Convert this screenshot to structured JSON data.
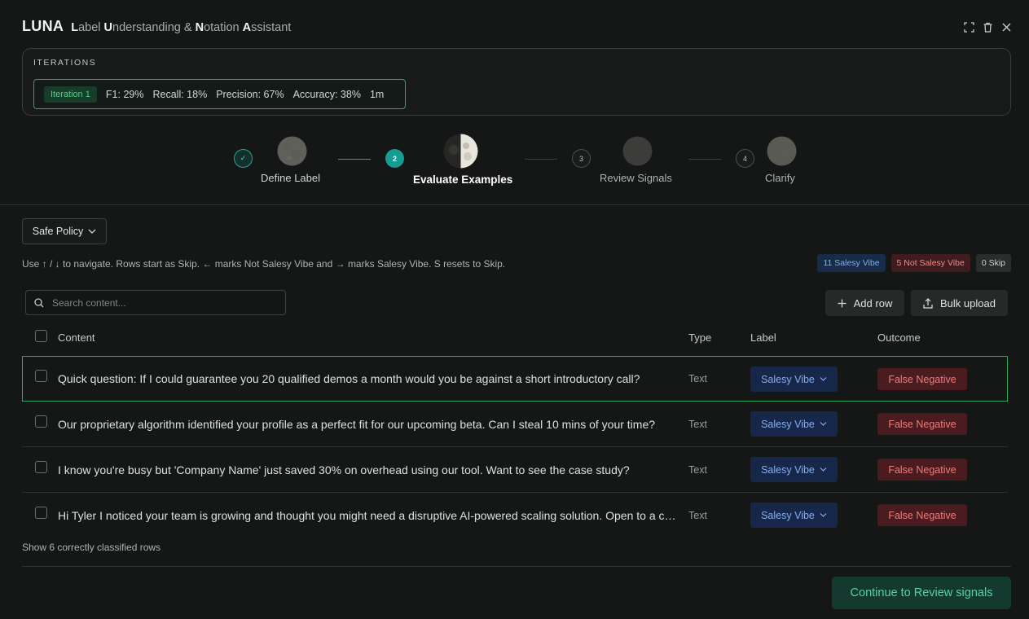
{
  "header": {
    "brand": "LUNA",
    "subtitle_parts": [
      {
        "b": "L",
        "t": "abel "
      },
      {
        "b": "U",
        "t": "nderstanding & "
      },
      {
        "b": "N",
        "t": "otation "
      },
      {
        "b": "A",
        "t": "ssistant"
      }
    ],
    "icons": [
      "expand-icon",
      "trash-icon",
      "close-icon"
    ]
  },
  "iterations": {
    "heading": "ITERATIONS",
    "items": [
      {
        "badge": "Iteration 1",
        "f1": "F1: 29%",
        "recall": "Recall: 18%",
        "precision": "Precision: 67%",
        "accuracy": "Accuracy: 38%",
        "time": "1m"
      }
    ]
  },
  "stepper": {
    "steps": [
      {
        "num": "✓",
        "label": "Define Label",
        "status": "done"
      },
      {
        "num": "2",
        "label": "Evaluate Examples",
        "status": "active"
      },
      {
        "num": "3",
        "label": "Review Signals",
        "status": "todo"
      },
      {
        "num": "4",
        "label": "Clarify",
        "status": "todo"
      }
    ]
  },
  "policy": {
    "selected": "Safe Policy"
  },
  "hint": "Use ↑ / ↓ to navigate. Rows start as Skip. ← marks Not Salesy Vibe and → marks Salesy Vibe. S resets to Skip.",
  "counts": {
    "positive": "11 Salesy Vibe",
    "negative": "5 Not Salesy Vibe",
    "skip": "0 Skip"
  },
  "search": {
    "placeholder": "Search content..."
  },
  "actions": {
    "add_row": "Add row",
    "bulk_upload": "Bulk upload"
  },
  "table": {
    "headers": {
      "content": "Content",
      "type": "Type",
      "label": "Label",
      "outcome": "Outcome"
    },
    "rows": [
      {
        "content": "Quick question: If I could guarantee you 20 qualified demos a month would you be against a short introductory call?",
        "type": "Text",
        "label": "Salesy Vibe",
        "outcome": "False Negative"
      },
      {
        "content": "Our proprietary algorithm identified your profile as a perfect fit for our upcoming beta. Can I steal 10 mins of your time?",
        "type": "Text",
        "label": "Salesy Vibe",
        "outcome": "False Negative"
      },
      {
        "content": "I know you're busy but 'Company Name' just saved 30% on overhead using our tool. Want to see the case study?",
        "type": "Text",
        "label": "Salesy Vibe",
        "outcome": "False Negative"
      },
      {
        "content": "Hi Tyler I noticed your team is growing and thought you might need a disruptive AI-powered scaling solution. Open to a chat?",
        "type": "Text",
        "label": "Salesy Vibe",
        "outcome": "False Negative"
      }
    ]
  },
  "footer": {
    "show_more": "Show 6 correctly classified rows",
    "continue": "Continue to Review signals"
  }
}
